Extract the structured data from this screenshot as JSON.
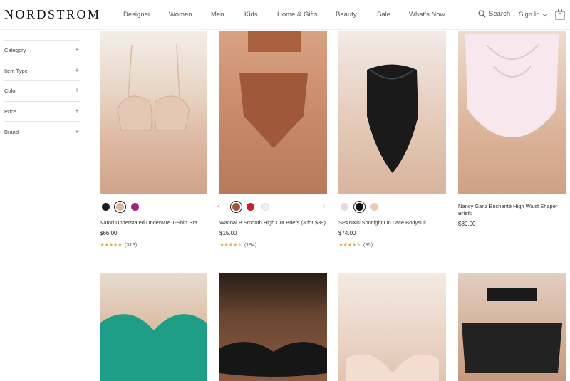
{
  "header": {
    "logo": "NORDSTROM",
    "nav": [
      "Designer",
      "Women",
      "Men",
      "Kids",
      "Home & Gifts",
      "Beauty",
      "Sale",
      "What's Now"
    ],
    "search_label": "Search",
    "signin_label": "Sign In",
    "bag_count": "0"
  },
  "filters": [
    {
      "label": "Category"
    },
    {
      "label": "Item Type"
    },
    {
      "label": "Color"
    },
    {
      "label": "Price"
    },
    {
      "label": "Brand"
    }
  ],
  "products": [
    {
      "name": "Natori Understated Underwire T-Shirt Bra",
      "price": "$66.00",
      "reviews": "(313)",
      "rating": 5,
      "swatches": [
        "#1c1c1c",
        "#d9b8a6",
        "#a3217f"
      ],
      "selected": 1
    },
    {
      "name": "Wacoal B Smooth High Cut Briefs (3 for $39)",
      "price": "$15.00",
      "reviews": "(194)",
      "rating": 4.5,
      "swatches": [
        "#a0583a",
        "#c8202a",
        "#f1f1f1"
      ],
      "selected": 0
    },
    {
      "name": "SPANX® Spotlight On Lace Bodysuit",
      "price": "$74.00",
      "reviews": "(35)",
      "rating": 4,
      "swatches": [
        "#ead9df",
        "#111111",
        "#efc7b4"
      ],
      "selected": 1
    },
    {
      "name": "Nancy Ganz Enchanté High Waist Shaper Briefs",
      "price": "$80.00"
    }
  ],
  "colors": {
    "star": "#d8b24a",
    "accent": "#111111"
  }
}
